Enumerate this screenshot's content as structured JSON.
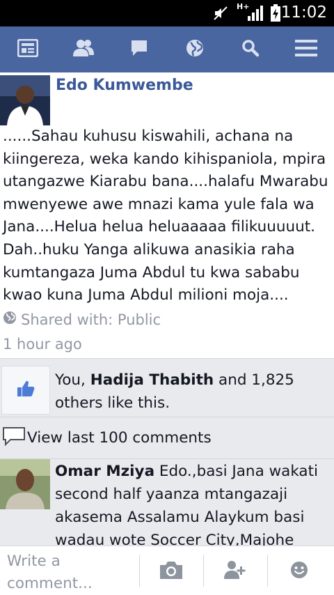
{
  "status_bar": {
    "network": "H+",
    "time": "11:02"
  },
  "nav": {
    "items": [
      {
        "name": "news-feed-icon"
      },
      {
        "name": "friends-icon"
      },
      {
        "name": "messages-icon"
      },
      {
        "name": "notifications-icon"
      },
      {
        "name": "search-icon"
      },
      {
        "name": "menu-icon"
      }
    ]
  },
  "post": {
    "author": "Edo Kumwembe",
    "text": "......Sahau kuhusu kiswahili, achana na kiingereza, weka kando kihispaniola, mpira utangazwe Kiarabu bana....halafu Mwarabu mwenyewe awe mnazi kama yule fala wa Jana....Helua helua heluaaaaa filikuuuuut. Dah..huku Yanga alikuwa anasikia raha kumtangaza Juma Abdul tu kwa sababu kwao kuna Juma Abdul milioni moja....",
    "privacy": "Shared with: Public",
    "timestamp": "1 hour ago"
  },
  "likes": {
    "prefix": "You, ",
    "highlighted_name": "Hadija Thabith",
    "suffix": " and 1,825 others like this."
  },
  "comments": {
    "view_more_label": "View last 100 comments",
    "items": [
      {
        "author": "Omar Mziya",
        "text": " Edo.,basi Jana wakati second half yaanza mtangazaji akasema Assalamu Alaykum basi wadau wote Soccer City,Majohe"
      }
    ]
  },
  "composer": {
    "placeholder": "Write a comment..."
  },
  "colors": {
    "nav_bg": "#4a66a0",
    "author_link": "#3b5998",
    "like_blue": "#4d7bd8",
    "meta_gray": "#9197a3"
  }
}
